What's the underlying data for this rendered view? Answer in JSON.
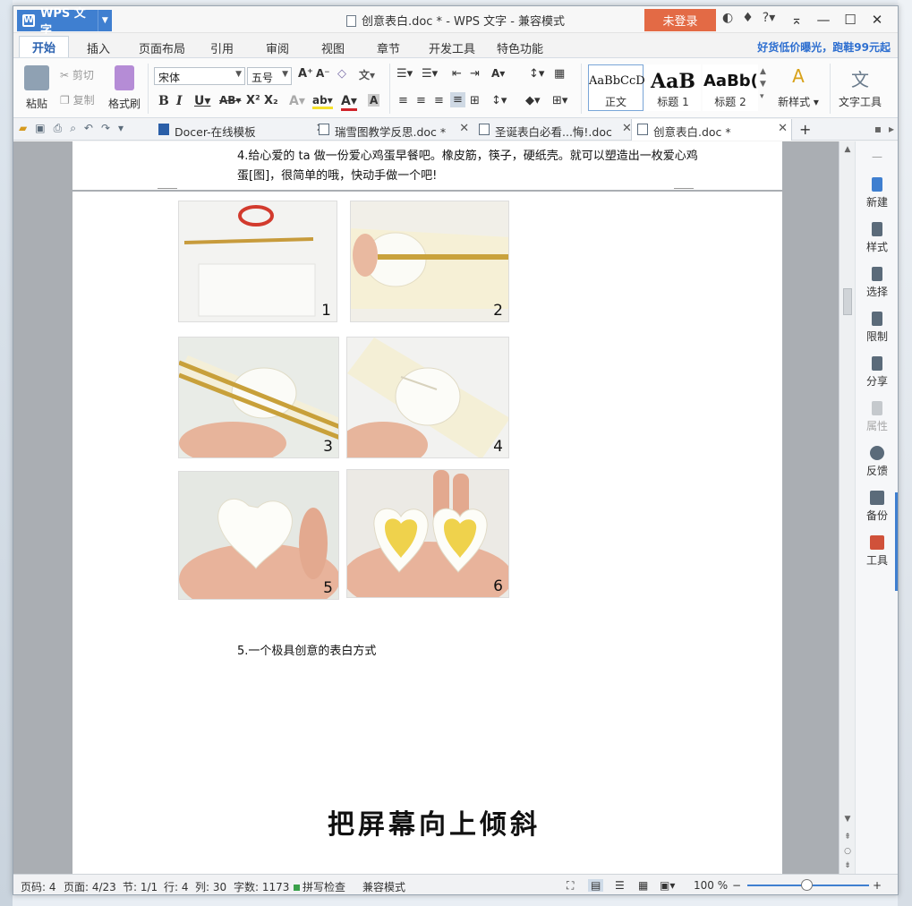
{
  "app": {
    "brand": "WPS 文字",
    "title": "创意表白.doc * - WPS 文字 - 兼容模式",
    "login": "未登录"
  },
  "ribbon_tabs": [
    "开始",
    "插入",
    "页面布局",
    "引用",
    "审阅",
    "视图",
    "章节",
    "开发工具",
    "特色功能"
  ],
  "promo": "好货低价曝光，跑鞋99元起",
  "clipboard": {
    "paste": "粘贴",
    "cut": "剪切",
    "copy": "复制",
    "format_painter": "格式刷"
  },
  "font": {
    "name": "宋体",
    "size": "五号"
  },
  "styles": [
    {
      "sample": "AaBbCcD",
      "name": "正文"
    },
    {
      "sample": "AaB",
      "name": "标题 1"
    },
    {
      "sample": "AaBb(",
      "name": "标题 2"
    }
  ],
  "ribbon_right": {
    "new_style": "新样式",
    "text_tools": "文字工具"
  },
  "doc_tabs": [
    {
      "label": "Docer-在线模板"
    },
    {
      "label": "瑞雪图教学反思.doc *"
    },
    {
      "label": "圣诞表白必看...悔!.doc"
    },
    {
      "label": "创意表白.doc *"
    }
  ],
  "document": {
    "para4_line1": "4.给心爱的 ta 做一份爱心鸡蛋早餐吧。橡皮筋，筷子，硬纸壳。就可以塑造出一枚爱心鸡",
    "para4_line2": "蛋[图]，很简单的哦，快动手做一个吧!",
    "photo_numbers": [
      "1",
      "2",
      "3",
      "4",
      "5",
      "6"
    ],
    "para5": "5.一个极具创意的表白方式",
    "handwriting": "把屏幕向上倾斜"
  },
  "side_panel": [
    "新建",
    "样式",
    "选择",
    "限制",
    "分享",
    "属性",
    "反馈",
    "备份",
    "工具"
  ],
  "status": {
    "page_code": "页码: 4",
    "pages": "页面: 4/23",
    "section": "节: 1/1",
    "line": "行: 4",
    "column": "列: 30",
    "words": "字数: 1173",
    "spell": "拼写检查",
    "mode": "兼容模式",
    "zoom": "100 %"
  },
  "colors": {
    "accent": "#3f7fd0",
    "login": "#e36a45",
    "promo": "#2e6fd0"
  }
}
